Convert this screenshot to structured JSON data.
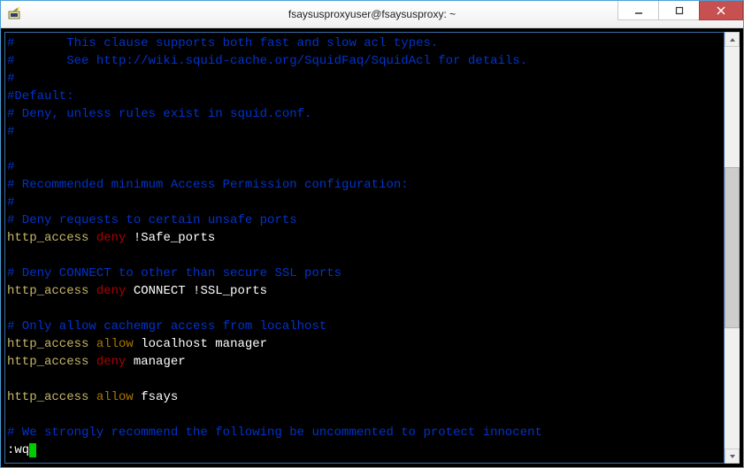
{
  "titlebar": {
    "title": "fsaysusproxyuser@fsaysusproxy: ~"
  },
  "terminal": {
    "l1": "#       This clause supports both fast and slow acl types.",
    "l2": "#       See http://wiki.squid-cache.org/SquidFaq/SquidAcl for details.",
    "l3": "#",
    "l4": "#Default:",
    "l5": "# Deny, unless rules exist in squid.conf.",
    "l6": "#",
    "l7": "",
    "l8": "#",
    "l9": "# Recommended minimum Access Permission configuration:",
    "l10": "#",
    "l11": "# Deny requests to certain unsafe ports",
    "r1_dir": "http_access",
    "r1_kw": "deny",
    "r1_arg": "!Safe_ports",
    "l13": "",
    "l14": "# Deny CONNECT to other than secure SSL ports",
    "r2_dir": "http_access",
    "r2_kw": "deny",
    "r2_arg": "CONNECT !SSL_ports",
    "l16": "",
    "l17": "# Only allow cachemgr access from localhost",
    "r3_dir": "http_access",
    "r3_kw": "allow",
    "r3_arg": "localhost manager",
    "r4_dir": "http_access",
    "r4_kw": "deny",
    "r4_arg": "manager",
    "l20": "",
    "r5_dir": "http_access",
    "r5_kw": "allow",
    "r5_arg": "fsays",
    "l22": "",
    "l23": "# We strongly recommend the following be uncommented to protect innocent",
    "cmd": ":wq"
  }
}
